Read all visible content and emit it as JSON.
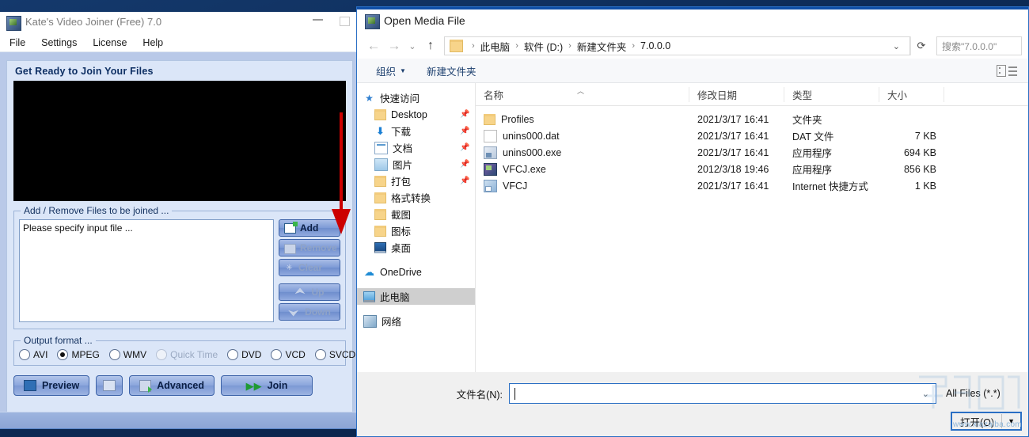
{
  "app": {
    "title": "Kate's Video Joiner (Free) 7.0",
    "menu": [
      "File",
      "Settings",
      "License",
      "Help"
    ],
    "heading": "Get Ready to Join Your Files",
    "files_group_legend": "Add / Remove Files to be joined ...",
    "files_list_text": "Please specify input file ...",
    "side_buttons": [
      {
        "label": "Add",
        "icon": "add-file-icon",
        "enabled": true
      },
      {
        "label": "Remove",
        "icon": "remove-icon",
        "enabled": false
      },
      {
        "label": "Clear",
        "icon": "clear-icon",
        "enabled": false
      },
      {
        "label": "Up",
        "icon": "arrow-up-icon",
        "enabled": false
      },
      {
        "label": "Down",
        "icon": "arrow-down-icon",
        "enabled": false
      }
    ],
    "format_group_legend": "Output format ...",
    "formats": [
      {
        "label": "AVI",
        "selected": false,
        "disabled": false
      },
      {
        "label": "MPEG",
        "selected": true,
        "disabled": false
      },
      {
        "label": "WMV",
        "selected": false,
        "disabled": false
      },
      {
        "label": "Quick Time",
        "selected": false,
        "disabled": true
      },
      {
        "label": "DVD",
        "selected": false,
        "disabled": false
      },
      {
        "label": "VCD",
        "selected": false,
        "disabled": false
      },
      {
        "label": "SVCD",
        "selected": false,
        "disabled": false
      }
    ],
    "preview_label": "Preview",
    "advanced_label": "Advanced",
    "join_label": "Join",
    "minimize_label": "Minimize",
    "maximize_label": "Maximize"
  },
  "dialog": {
    "title": "Open Media File",
    "nav": {
      "back": "←",
      "forward": "→",
      "recent": "⌄",
      "up": "↑"
    },
    "breadcrumbs": [
      "此电脑",
      "软件 (D:)",
      "新建文件夹",
      "7.0.0.0"
    ],
    "search_placeholder": "搜索\"7.0.0.0\"",
    "refresh_label": "刷新",
    "commands": [
      "组织",
      "新建文件夹"
    ],
    "nav_pane": [
      {
        "label": "快速访问",
        "icon": "star-icon",
        "indent": false,
        "pinned": false,
        "selected": false
      },
      {
        "label": "Desktop",
        "icon": "folder-icon",
        "indent": true,
        "pinned": true,
        "selected": false
      },
      {
        "label": "下载",
        "icon": "download-icon",
        "indent": true,
        "pinned": true,
        "selected": false
      },
      {
        "label": "文档",
        "icon": "document-icon",
        "indent": true,
        "pinned": true,
        "selected": false
      },
      {
        "label": "图片",
        "icon": "pictures-icon",
        "indent": true,
        "pinned": true,
        "selected": false
      },
      {
        "label": "打包",
        "icon": "folder-icon",
        "indent": true,
        "pinned": true,
        "selected": false
      },
      {
        "label": "格式转换",
        "icon": "folder-icon",
        "indent": true,
        "pinned": false,
        "selected": false
      },
      {
        "label": "截图",
        "icon": "folder-icon",
        "indent": true,
        "pinned": false,
        "selected": false
      },
      {
        "label": "图标",
        "icon": "folder-icon",
        "indent": true,
        "pinned": false,
        "selected": false
      },
      {
        "label": "桌面",
        "icon": "desktop-icon",
        "indent": true,
        "pinned": false,
        "selected": false
      },
      {
        "label": "OneDrive",
        "icon": "cloud-icon",
        "indent": false,
        "pinned": false,
        "selected": false
      },
      {
        "label": "此电脑",
        "icon": "this-pc-icon",
        "indent": false,
        "pinned": false,
        "selected": true
      },
      {
        "label": "网络",
        "icon": "network-icon",
        "indent": false,
        "pinned": false,
        "selected": false
      }
    ],
    "columns": [
      "名称",
      "修改日期",
      "类型",
      "大小"
    ],
    "rows": [
      {
        "name": "Profiles",
        "date": "2021/3/17 16:41",
        "type": "文件夹",
        "size": "",
        "icon": "folder-icon"
      },
      {
        "name": "unins000.dat",
        "date": "2021/3/17 16:41",
        "type": "DAT 文件",
        "size": "7 KB",
        "icon": "dat-file-icon"
      },
      {
        "name": "unins000.exe",
        "date": "2021/3/17 16:41",
        "type": "应用程序",
        "size": "694 KB",
        "icon": "exe-file-icon"
      },
      {
        "name": "VFCJ.exe",
        "date": "2012/3/18 19:46",
        "type": "应用程序",
        "size": "856 KB",
        "icon": "app-icon"
      },
      {
        "name": "VFCJ",
        "date": "2021/3/17 16:41",
        "type": "Internet 快捷方式",
        "size": "1 KB",
        "icon": "shortcut-icon"
      }
    ],
    "filename_label": "文件名(N):",
    "filename_value": "",
    "filter_value": "All Files (*.*)",
    "open_button": "打开(O)",
    "watermark": "www.xiazaiba.com"
  },
  "annotation": {
    "arrow_color": "#cc0000",
    "points_to": "Add"
  }
}
